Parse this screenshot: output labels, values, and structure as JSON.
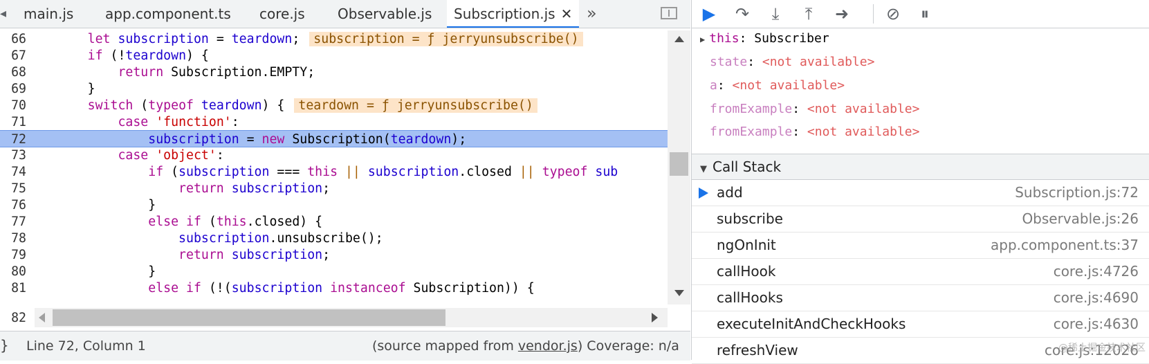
{
  "tabs": [
    {
      "label": "main.js"
    },
    {
      "label": "app.component.ts"
    },
    {
      "label": "core.js"
    },
    {
      "label": "Observable.js"
    },
    {
      "label": "Subscription.js",
      "close": "✕"
    }
  ],
  "more_tabs": "»",
  "code_lines": [
    {
      "num": "66"
    },
    {
      "num": "67"
    },
    {
      "num": "68"
    },
    {
      "num": "69"
    },
    {
      "num": "70"
    },
    {
      "num": "71"
    },
    {
      "num": "72"
    },
    {
      "num": "73"
    },
    {
      "num": "74"
    },
    {
      "num": "75"
    },
    {
      "num": "76"
    },
    {
      "num": "77"
    },
    {
      "num": "78"
    },
    {
      "num": "79"
    },
    {
      "num": "80"
    },
    {
      "num": "81"
    },
    {
      "num": "82"
    }
  ],
  "inline_values": {
    "l66": "subscription = ƒ jerryunsubscribe()",
    "l70": "teardown = ƒ jerryunsubscribe()"
  },
  "status": {
    "brace": "}",
    "position": "Line 72, Column 1",
    "mapped_prefix": "(source mapped from ",
    "mapped_file": "vendor.js",
    "mapped_suffix": ")",
    "coverage": "Coverage: n/a"
  },
  "scope": {
    "this_key": "this",
    "this_val": "Subscriber",
    "items": [
      {
        "key": "state",
        "value": "<not available>"
      },
      {
        "key": "a",
        "value": "<not available>"
      },
      {
        "key": "fromExample",
        "value": "<not available>"
      },
      {
        "key": "fromExample",
        "value": "<not available>"
      }
    ]
  },
  "call_stack": {
    "title": "Call Stack",
    "frames": [
      {
        "fn": "add",
        "loc": "Subscription.js:72"
      },
      {
        "fn": "subscribe",
        "loc": "Observable.js:26"
      },
      {
        "fn": "ngOnInit",
        "loc": "app.component.ts:37"
      },
      {
        "fn": "callHook",
        "loc": "core.js:4726"
      },
      {
        "fn": "callHooks",
        "loc": "core.js:4690"
      },
      {
        "fn": "executeInitAndCheckHooks",
        "loc": "core.js:4630"
      },
      {
        "fn": "refreshView",
        "loc": "core.js:12026"
      }
    ]
  },
  "watermark": "@稀土掘金技术社区"
}
